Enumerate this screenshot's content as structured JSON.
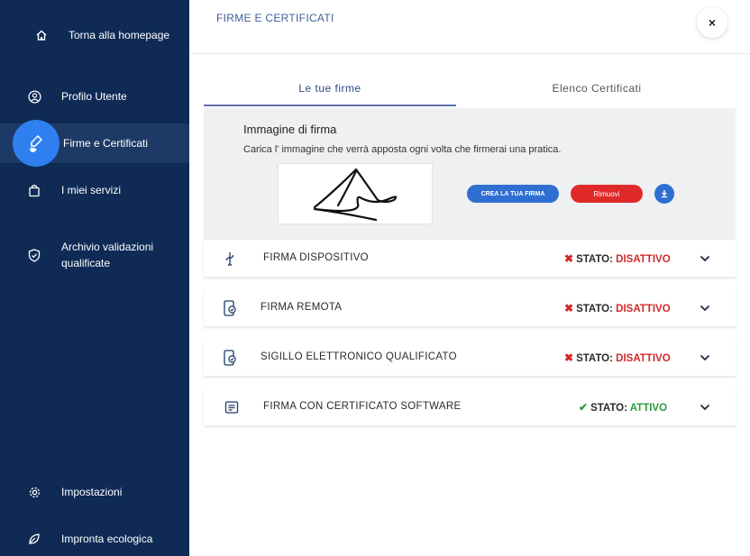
{
  "sidebar": {
    "home_label": "Torna alla homepage",
    "items": [
      {
        "label": "Profilo Utente",
        "icon": "user-circle-icon"
      },
      {
        "label": "Firme e Certificati",
        "icon": "signature-hand-icon"
      },
      {
        "label": "I miei servizi",
        "icon": "bag-icon"
      },
      {
        "label": "Archivio validazioni qualificate",
        "icon": "shield-check-icon"
      },
      {
        "label": "Impostazioni",
        "icon": "gear-icon"
      },
      {
        "label": "Impronta ecologica",
        "icon": "leaf-icon"
      }
    ],
    "active_item": "Firme e Certificati",
    "colors": {
      "background": "#0f2b55",
      "active_bubble": "#2f7ff0"
    }
  },
  "header": {
    "title": "FIRME E CERTIFICATI",
    "close_label": "×"
  },
  "tabs": [
    {
      "label": "Le tue firme",
      "active": true
    },
    {
      "label": "Elenco Certificati",
      "active": false
    }
  ],
  "signature": {
    "title": "Immagine di firma",
    "description": "Carica l' immagine che verrà apposta ogni volta che firmerai una pratica.",
    "create_label": "CREA LA TUA FIRMA",
    "remove_label": "Rimuovi"
  },
  "rows": [
    {
      "label": "FIRMA DISPOSITIVO",
      "icon": "usb-icon",
      "status_prefix": "STATO:",
      "status_value": "DISATTIVO",
      "status_mark": "✖"
    },
    {
      "label": "FIRMA REMOTA",
      "icon": "phone-check-icon",
      "status_prefix": "STATO:",
      "status_value": "DISATTIVO",
      "status_mark": "✖"
    },
    {
      "label": "SIGILLO ELETTRONICO QUALIFICATO",
      "icon": "phone-check-icon",
      "status_prefix": "STATO:",
      "status_value": "DISATTIVO",
      "status_mark": "✖"
    },
    {
      "label": "FIRMA CON CERTIFICATO SOFTWARE",
      "icon": "document-icon",
      "status_prefix": "STATO:",
      "status_value": "ATTIVO",
      "status_mark": "✔"
    }
  ],
  "colors": {
    "accent": "#2f6fd1",
    "danger": "#e02a2a",
    "inactive": "#d12a2a",
    "active": "#2b9a3e"
  }
}
